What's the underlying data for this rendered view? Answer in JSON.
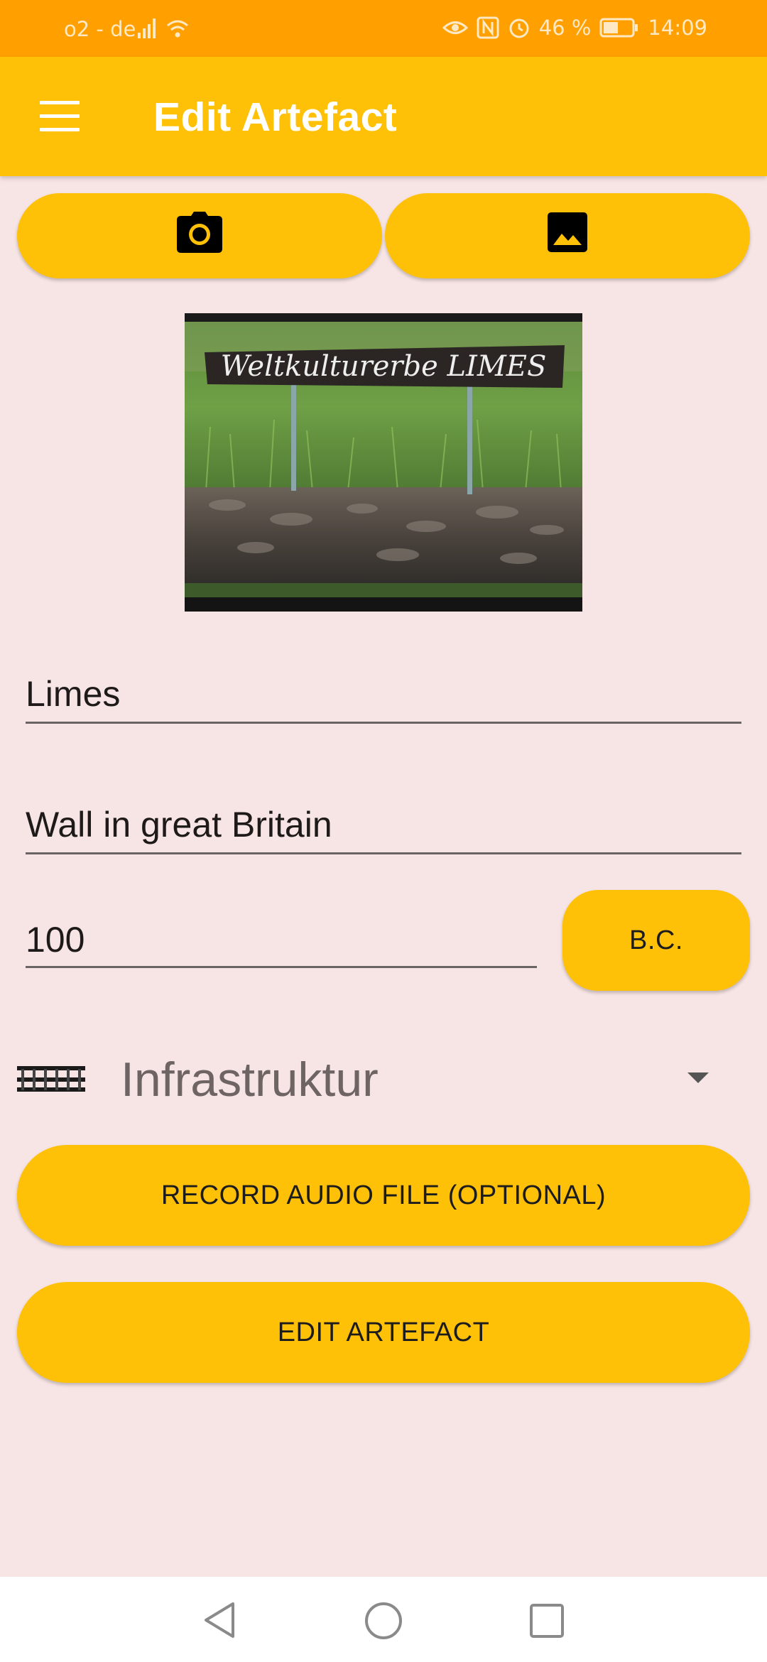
{
  "status": {
    "carrier": "o2 - de",
    "battery": "46 %",
    "time": "14:09"
  },
  "app_bar": {
    "title": "Edit Artefact"
  },
  "image_sign_text": "Weltkulturerbe LIMES",
  "form": {
    "name": "Limes",
    "description": "Wall in great Britain",
    "year": "100",
    "era_label": "B.C.",
    "category": "Infrastruktur"
  },
  "buttons": {
    "record_audio": "RECORD AUDIO FILE (OPTIONAL)",
    "edit_artefact": "EDIT ARTEFACT"
  },
  "colors": {
    "primary": "#ffc107",
    "status_bar": "#ffa000",
    "background": "#f7e4e4"
  },
  "icons": [
    "menu-icon",
    "camera-icon",
    "gallery-image-icon",
    "dropdown-arrow-icon",
    "back-icon",
    "home-icon",
    "recents-icon"
  ]
}
